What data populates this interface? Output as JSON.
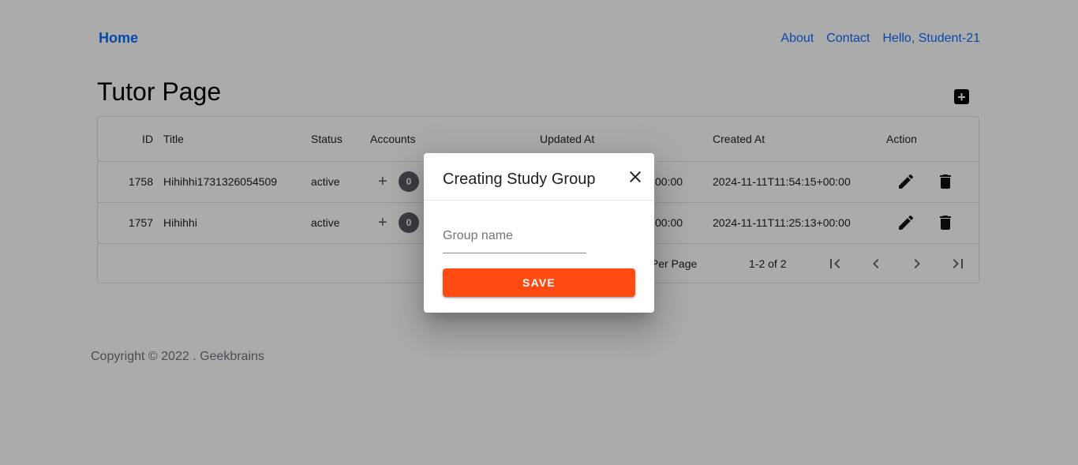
{
  "nav": {
    "home": "Home",
    "about": "About",
    "contact": "Contact",
    "greeting": "Hello, Student-21"
  },
  "page": {
    "title": "Tutor Page",
    "add_icon": "plus-box-icon"
  },
  "table": {
    "headers": {
      "id": "ID",
      "title": "Title",
      "status": "Status",
      "accounts": "Accounts",
      "updated_at": "Updated At",
      "created_at": "Created At",
      "action": "Action"
    },
    "rows": [
      {
        "id": "1758",
        "title": "Hihihhi1731326054509",
        "status": "active",
        "accounts_plus": "+",
        "accounts_count": "0",
        "updated_at_visible": "00:00",
        "created_at": "2024-11-11T11:54:15+00:00"
      },
      {
        "id": "1757",
        "title": "Hihihhi",
        "status": "active",
        "accounts_plus": "+",
        "accounts_count": "0",
        "updated_at_visible": "00:00",
        "created_at": "2024-11-11T11:25:13+00:00"
      }
    ],
    "pagination": {
      "rows_per_page_visible": "s Per Page",
      "range": "1-2 of 2"
    }
  },
  "footer": {
    "copyright": "Copyright © 2022 . Geekbrains"
  },
  "dialog": {
    "title": "Creating Study Group",
    "field_placeholder": "Group name",
    "field_value": "",
    "save_label": "SAVE"
  },
  "colors": {
    "link": "#0d6efd",
    "save_button": "#ff4a11",
    "badge": "#5b5b66"
  }
}
